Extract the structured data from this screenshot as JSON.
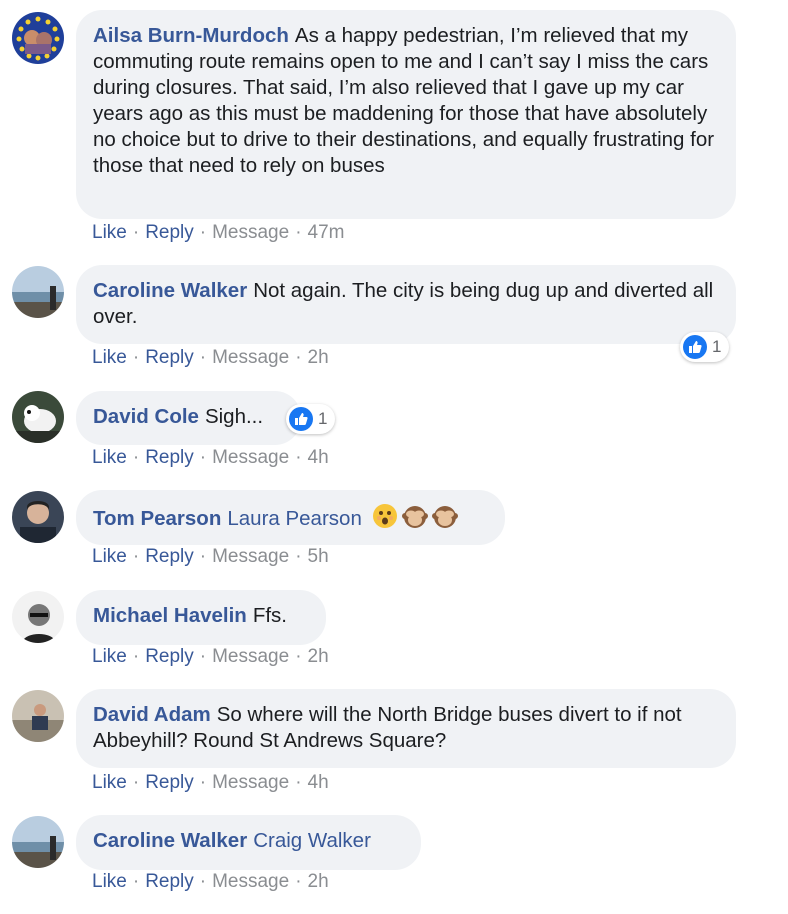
{
  "actions": {
    "like": "Like",
    "reply": "Reply",
    "message": "Message",
    "dot": "·"
  },
  "comments": [
    {
      "author": "Ailsa Burn-Murdoch",
      "text": "As a happy pedestrian, I’m relieved that my commuting route remains open to me and I can’t say I miss the cars during closures. That said, I’m also relieved that I gave up my car years ago as this must be maddening for those that have absolutely no choice but to drive to their destinations, and equally frustrating for those that need to rely on buses",
      "time": "47m"
    },
    {
      "author": "Caroline Walker",
      "text": "Not again. The city is being dug up and diverted all over.",
      "time": "2h",
      "likes": "1"
    },
    {
      "author": "David Cole",
      "text": "Sigh...",
      "time": "4h",
      "likes": "1"
    },
    {
      "author": "Tom Pearson",
      "mention": "Laura Pearson",
      "emojis": [
        "astonished-face",
        "see-no-evil-monkey",
        "see-no-evil-monkey"
      ],
      "time": "5h"
    },
    {
      "author": "Michael Havelin",
      "text": "Ffs.",
      "time": "2h"
    },
    {
      "author": "David Adam",
      "text": "So where will the North Bridge buses divert to if not Abbeyhill? Round St Andrews Square?",
      "time": "4h"
    },
    {
      "author": "Caroline Walker",
      "mention": "Craig Walker",
      "time": "2h"
    }
  ],
  "colors": {
    "link": "#385898",
    "bubble": "#f0f2f5",
    "like_blue": "#1877f2",
    "meta": "#8a8d91"
  }
}
